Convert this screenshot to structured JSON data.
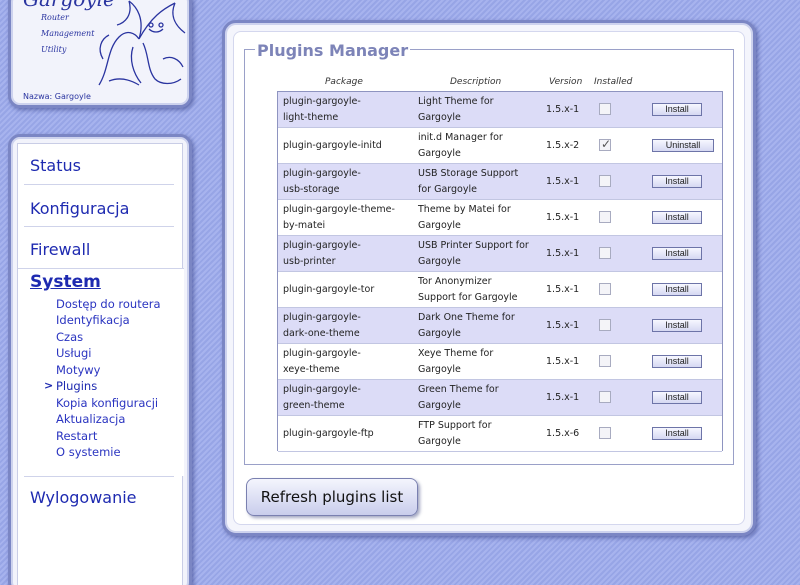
{
  "logo": {
    "title": "Gargoyle",
    "sub1": "Router",
    "sub2": "Management",
    "sub3": "Utility",
    "name_label": "Nazwa: Gargoyle"
  },
  "nav": {
    "status": "Status",
    "konfiguracja": "Konfiguracja",
    "firewall": "Firewall",
    "system": "System",
    "system_items": [
      "Dostęp do routera",
      "Identyfikacja",
      "Czas",
      "Usługi",
      "Motywy",
      "Plugins",
      "Kopia konfiguracji",
      "Aktualizacja",
      "Restart",
      "O systemie"
    ],
    "active_marker": ">",
    "logout": "Wylogowanie"
  },
  "main": {
    "title": "Plugins Manager",
    "columns": {
      "package": "Package",
      "description": "Description",
      "version": "Version",
      "installed": "Installed"
    },
    "plugins": [
      {
        "pkg1": "plugin-gargoyle-",
        "pkg2": "light-theme",
        "desc1": "Light Theme for",
        "desc2": "Gargoyle",
        "version": "1.5.x-1",
        "installed": false,
        "action": "Install"
      },
      {
        "pkg1": "plugin-gargoyle-initd",
        "pkg2": "",
        "desc1": "init.d Manager for",
        "desc2": "Gargoyle",
        "version": "1.5.x-2",
        "installed": true,
        "action": "Uninstall"
      },
      {
        "pkg1": "plugin-gargoyle-",
        "pkg2": "usb-storage",
        "desc1": "USB Storage Support",
        "desc2": "for Gargoyle",
        "version": "1.5.x-1",
        "installed": false,
        "action": "Install"
      },
      {
        "pkg1": "plugin-gargoyle-theme-",
        "pkg2": "by-matei",
        "desc1": "Theme by Matei for",
        "desc2": "Gargoyle",
        "version": "1.5.x-1",
        "installed": false,
        "action": "Install"
      },
      {
        "pkg1": "plugin-gargoyle-",
        "pkg2": "usb-printer",
        "desc1": "USB Printer Support for",
        "desc2": "Gargoyle",
        "version": "1.5.x-1",
        "installed": false,
        "action": "Install"
      },
      {
        "pkg1": "plugin-gargoyle-tor",
        "pkg2": "",
        "desc1": "Tor Anonymizer",
        "desc2": "Support for Gargoyle",
        "version": "1.5.x-1",
        "installed": false,
        "action": "Install"
      },
      {
        "pkg1": "plugin-gargoyle-",
        "pkg2": "dark-one-theme",
        "desc1": "Dark One Theme for",
        "desc2": "Gargoyle",
        "version": "1.5.x-1",
        "installed": false,
        "action": "Install"
      },
      {
        "pkg1": "plugin-gargoyle-",
        "pkg2": "xeye-theme",
        "desc1": "Xeye Theme for",
        "desc2": "Gargoyle",
        "version": "1.5.x-1",
        "installed": false,
        "action": "Install"
      },
      {
        "pkg1": "plugin-gargoyle-",
        "pkg2": "green-theme",
        "desc1": "Green Theme for",
        "desc2": "Gargoyle",
        "version": "1.5.x-1",
        "installed": false,
        "action": "Install"
      },
      {
        "pkg1": "plugin-gargoyle-ftp",
        "pkg2": "",
        "desc1": "FTP Support for",
        "desc2": "Gargoyle",
        "version": "1.5.x-6",
        "installed": false,
        "action": "Install"
      }
    ],
    "refresh_label": "Refresh plugins list"
  },
  "colors": {
    "accent": "#1e2ab0",
    "row_alt": "#dcdcf7",
    "legend": "#7d84b8"
  }
}
